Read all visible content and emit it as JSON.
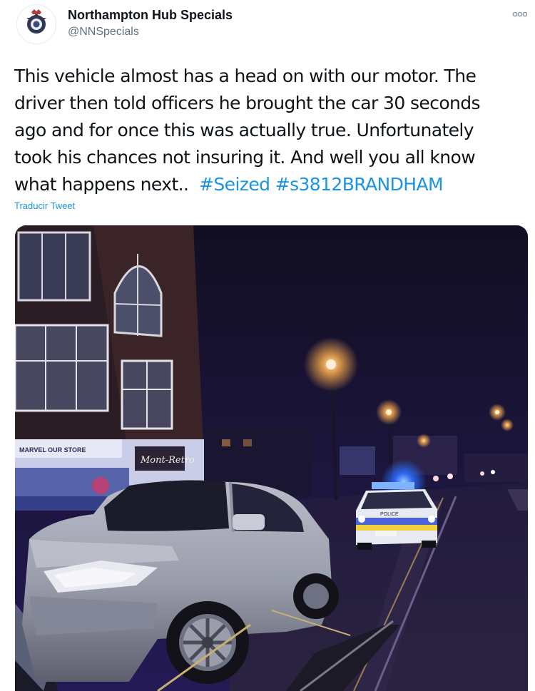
{
  "tweet": {
    "author_name": "Northampton Hub Specials",
    "author_handle": "@NNSpecials",
    "text_lines": [
      "This vehicle almost has a head on with our motor. The",
      "driver then told officers he brought the car 30 seconds",
      "ago and for once this was actually true. Unfortunately",
      "took his chances not insuring it. And well you all know"
    ],
    "last_line_text": "what happens next..",
    "hashtags": [
      "#Seized",
      "#s3812BRANDHAM"
    ],
    "translate_label": "Traducir Tweet"
  },
  "photo": {
    "shop_sign_left": "MARVEL OUR STORE",
    "shop_sign_right": "Mont-Retro",
    "police_car_label": "POLICE"
  },
  "colors": {
    "link": "#1b95e0",
    "text": "#0f1419",
    "secondary": "#5b7083"
  },
  "icons": {
    "avatar": "police-badge-icon",
    "more": "more-options-icon"
  }
}
